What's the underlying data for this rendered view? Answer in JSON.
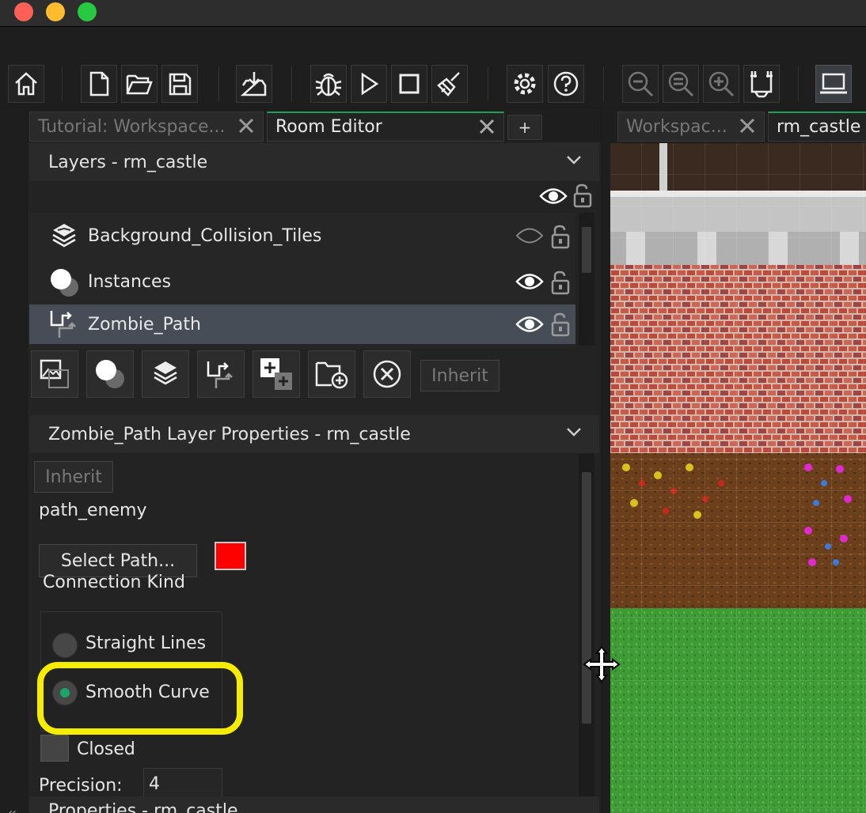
{
  "window": {
    "traffic_lights": [
      "close",
      "minimize",
      "maximize"
    ]
  },
  "toolbar": {
    "buttons": [
      {
        "name": "home-icon"
      },
      {
        "name": "new-file-icon"
      },
      {
        "name": "open-folder-icon"
      },
      {
        "name": "save-icon"
      },
      {
        "name": "export-icon"
      },
      {
        "name": "debug-icon"
      },
      {
        "name": "run-icon"
      },
      {
        "name": "stop-icon"
      },
      {
        "name": "clean-icon"
      },
      {
        "name": "settings-icon"
      },
      {
        "name": "help-icon"
      },
      {
        "name": "zoom-out-icon"
      },
      {
        "name": "zoom-reset-icon"
      },
      {
        "name": "zoom-in-icon"
      },
      {
        "name": "fit-icon"
      },
      {
        "name": "target-device-icon"
      }
    ]
  },
  "left_tabs": [
    {
      "label": "Tutorial: Workspace...",
      "active": false
    },
    {
      "label": "Room Editor",
      "active": true
    }
  ],
  "add_tab_label": "+",
  "layers": {
    "header": "Layers - rm_castle",
    "items": [
      {
        "label": "Background_Collision_Tiles",
        "icon": "tile-layer-icon",
        "visible": false,
        "selected": false
      },
      {
        "label": "Instances",
        "icon": "instance-layer-icon",
        "visible": true,
        "selected": false
      },
      {
        "label": "Zombie_Path",
        "icon": "path-layer-icon",
        "visible": true,
        "selected": true
      }
    ],
    "inherit_label": "Inherit"
  },
  "layer_properties": {
    "header": "Zombie_Path Layer Properties - rm_castle",
    "inherit_label": "Inherit",
    "path_name": "path_enemy",
    "select_path_label": "Select Path...",
    "path_color": "#ff0000",
    "connection_kind_label": "Connection Kind",
    "options": [
      {
        "label": "Straight Lines",
        "checked": false
      },
      {
        "label": "Smooth Curve",
        "checked": true
      }
    ],
    "closed_label": "Closed",
    "closed": false,
    "precision_label": "Precision:",
    "precision_value": "4"
  },
  "properties_header": "Properties - rm_castle",
  "right_tabs": [
    {
      "label": "Workspac...",
      "active": false
    },
    {
      "label": "rm_castle",
      "active": true
    }
  ],
  "colors": {
    "accent_green": "#1fa05a",
    "highlight_yellow": "#f5ec00",
    "selected_row": "#464d57"
  }
}
